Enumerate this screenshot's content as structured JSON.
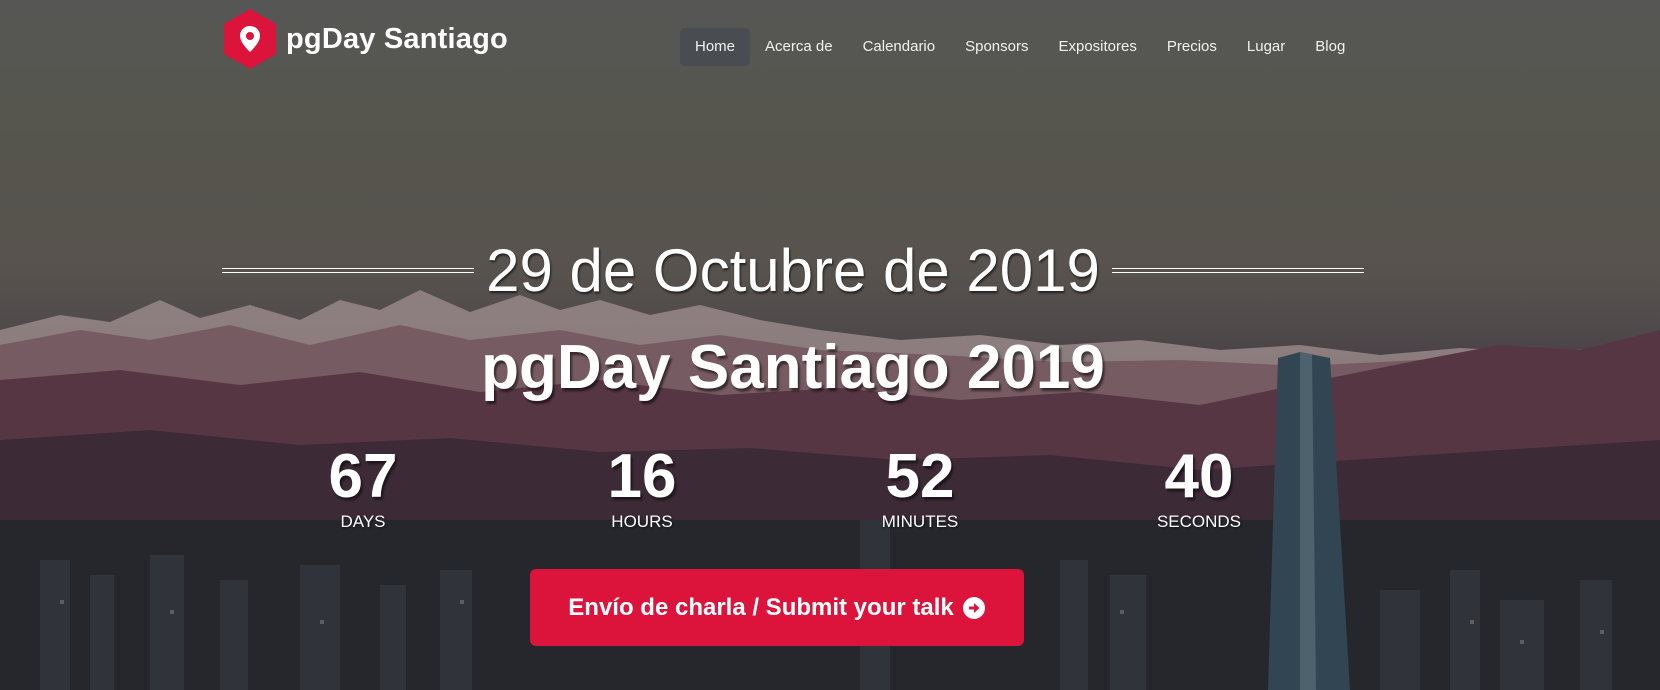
{
  "brand": {
    "name": "pgDay Santiago",
    "logo_color": "#dc143c"
  },
  "nav": {
    "items": [
      {
        "label": "Home",
        "active": true
      },
      {
        "label": "Acerca de",
        "active": false
      },
      {
        "label": "Calendario",
        "active": false
      },
      {
        "label": "Sponsors",
        "active": false
      },
      {
        "label": "Expositores",
        "active": false
      },
      {
        "label": "Precios",
        "active": false
      },
      {
        "label": "Lugar",
        "active": false
      },
      {
        "label": "Blog",
        "active": false
      }
    ]
  },
  "hero": {
    "date": "29 de Octubre de 2019",
    "title": "pgDay Santiago 2019",
    "countdown": [
      {
        "value": "67",
        "label": "DAYS"
      },
      {
        "value": "16",
        "label": "HOURS"
      },
      {
        "value": "52",
        "label": "MINUTES"
      },
      {
        "value": "40",
        "label": "SECONDS"
      }
    ],
    "cta": {
      "label": "Envío de charla / Submit your talk",
      "icon": "arrow-circle-right-icon",
      "color": "#dc143c"
    }
  }
}
